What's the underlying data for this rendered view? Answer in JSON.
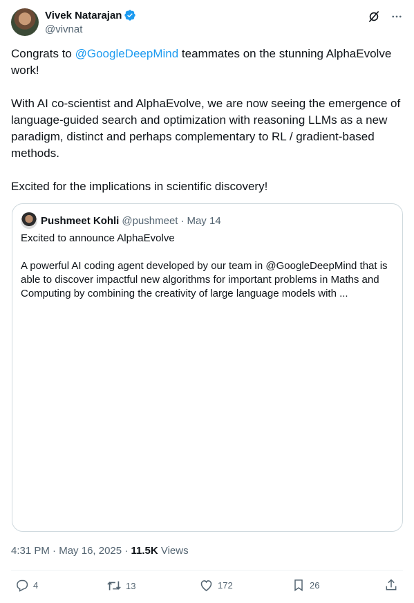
{
  "author": {
    "display_name": "Vivek Natarajan",
    "handle": "@vivnat",
    "verified_icon": "verified-badge-icon",
    "brand_color": "#1d9bf0"
  },
  "header_icons": [
    "grok-icon",
    "more-icon"
  ],
  "tweet": {
    "para1_before": "Congrats to ",
    "para1_mention": "@GoogleDeepMind",
    "para1_after": " teammates on the stunning AlphaEvolve work!",
    "para2": "With AI co-scientist and AlphaEvolve, we are now seeing the emergence of language-guided search and optimization with reasoning LLMs as a new paradigm, distinct and perhaps complementary to RL / gradient-based methods.",
    "para3": "Excited for the implications in scientific discovery!"
  },
  "quote": {
    "display_name": "Pushmeet Kohli",
    "handle": "@pushmeet",
    "separator": "·",
    "date": "May 14",
    "line1": "Excited to announce AlphaEvolve",
    "line2": "A powerful AI coding agent developed by our team in @GoogleDeepMind that is able to discover impactful new algorithms for important problems in Maths and Computing by combining the creativity of large language models with ..."
  },
  "meta": {
    "time": "4:31 PM",
    "dot": "·",
    "date": "May 16, 2025",
    "views_count": "11.5K",
    "views_label": "Views"
  },
  "actions": {
    "replies": "4",
    "reposts": "13",
    "likes": "172",
    "bookmarks": "26"
  }
}
